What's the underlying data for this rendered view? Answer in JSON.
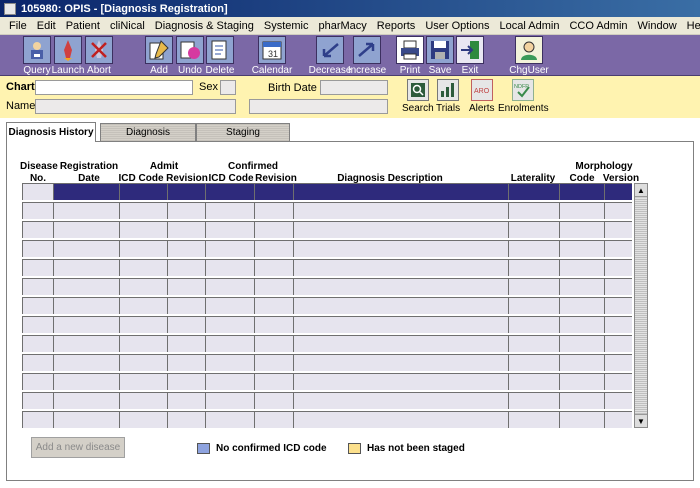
{
  "window": {
    "title": "105980: OPIS - [Diagnosis Registration]"
  },
  "menu": [
    "File",
    "Edit",
    "Patient",
    "cliNical",
    "Diagnosis & Staging",
    "Systemic",
    "pharMacy",
    "Reports",
    "User Options",
    "Local Admin",
    "CCO Admin",
    "Window",
    "Help"
  ],
  "toolbar": {
    "buttons": [
      {
        "label": "Query",
        "icon": "query-icon"
      },
      {
        "label": "Launch",
        "icon": "launch-icon"
      },
      {
        "label": "Abort",
        "icon": "abort-icon"
      },
      {
        "label": "Add",
        "icon": "add-icon"
      },
      {
        "label": "Undo",
        "icon": "undo-icon"
      },
      {
        "label": "Delete",
        "icon": "delete-icon"
      },
      {
        "label": "Calendar",
        "icon": "calendar-icon"
      },
      {
        "label": "Decrease",
        "icon": "decrease-icon"
      },
      {
        "label": "Increase",
        "icon": "increase-icon"
      },
      {
        "label": "Print",
        "icon": "printer-icon"
      },
      {
        "label": "Save",
        "icon": "save-icon"
      },
      {
        "label": "Exit",
        "icon": "exit-icon"
      },
      {
        "label": "ChgUser",
        "icon": "change-user-icon"
      }
    ]
  },
  "patient": {
    "chart_label": "Chart",
    "chart_value": "",
    "sex_label": "Sex",
    "sex_value": "",
    "birth_date_label": "Birth Date",
    "birth_date_value": "",
    "name_label": "Name",
    "name_value": ""
  },
  "actions": [
    {
      "label": "Search",
      "icon": "search-icon"
    },
    {
      "label": "Trials",
      "icon": "trials-icon"
    },
    {
      "label": "Alerts",
      "icon": "alerts-icon",
      "icon_text": "ARO"
    },
    {
      "label": "Enrolments",
      "icon": "enrolments-icon",
      "icon_text": "NDFP"
    }
  ],
  "tabs": [
    {
      "label": "Diagnosis History",
      "active": true
    },
    {
      "label": "Diagnosis",
      "active": false
    },
    {
      "label": "Staging",
      "active": false
    }
  ],
  "grid": {
    "headers": {
      "disease": "Disease",
      "no": "No.",
      "registration": "Registration",
      "date": "Date",
      "admit": "Admit",
      "confirmed": "Confirmed",
      "icd_code_1": "ICD Code",
      "revision_1": "Revision",
      "icd_code_2": "ICD Code",
      "revision_2": "Revision",
      "diagnosis_description": "Diagnosis Description",
      "laterality": "Laterality",
      "morphology": "Morphology",
      "code": "Code",
      "version": "Version"
    },
    "row_count": 13,
    "selected_row": 0
  },
  "footer": {
    "add_button": "Add a new disease",
    "legend": [
      {
        "label": "No confirmed ICD code",
        "color": "#8EA3DF"
      },
      {
        "label": "Has not been staged",
        "color": "#FCE08C"
      }
    ]
  },
  "colors": {
    "toolbar_bg": "#7B68A6",
    "patient_band_bg": "#FFF3B0",
    "selected_row": "#2E2A7C",
    "grid_cell": "#E6E4EE"
  }
}
